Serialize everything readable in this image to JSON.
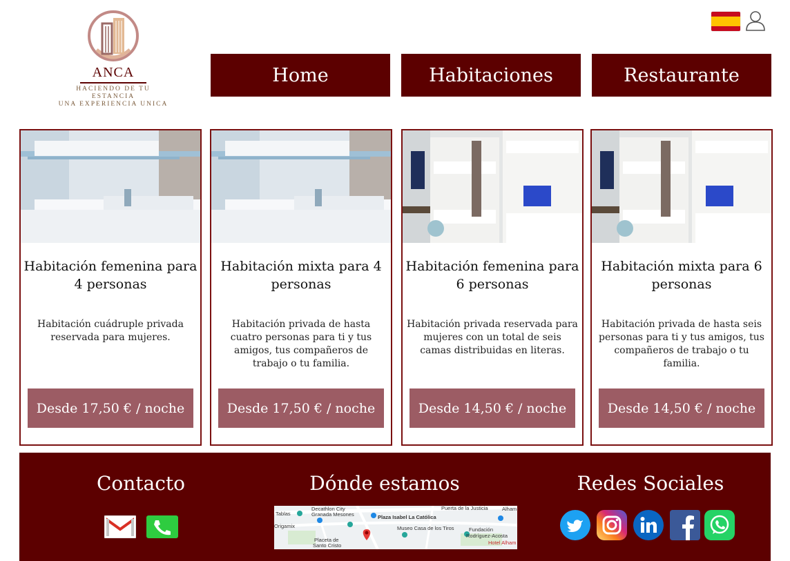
{
  "brand": {
    "name": "ANCA",
    "tagline_1": "HACIENDO DE TU ESTANCIA",
    "tagline_2": "UNA EXPERIENCIA UNICA"
  },
  "colors": {
    "primary": "#5c0000",
    "price_button": "#9c5c64",
    "card_border": "#7a1010"
  },
  "header_icons": {
    "language": "spain-flag-icon",
    "account": "user-icon"
  },
  "nav": [
    {
      "label": "Home"
    },
    {
      "label": "Habitaciones"
    },
    {
      "label": "Restaurante"
    }
  ],
  "rooms": [
    {
      "title": "Habitación femenina para 4 personas",
      "description": "Habitación cuádruple privada reservada para mujeres.",
      "price": "Desde 17,50 € / noche"
    },
    {
      "title": "Habitación mixta para 4 personas",
      "description": "Habitación privada de hasta cuatro personas para ti y tus amigos, tus compañeros de trabajo o tu familia.",
      "price": "Desde 17,50 € / noche"
    },
    {
      "title": "Habitación femenina para 6 personas",
      "description": "Habitación privada reservada para mujeres con un total de seis camas distribuidas en literas.",
      "price": "Desde 14,50 € / noche"
    },
    {
      "title": "Habitación mixta para 6 personas",
      "description": "Habitación privada de hasta seis personas para ti y tus amigos, tus compañeros de trabajo o tu familia.",
      "price": "Desde 14,50 € / noche"
    }
  ],
  "footer": {
    "contact_title": "Contacto",
    "location_title": "Dónde estamos",
    "social_title": "Redes Sociales",
    "contact_icons": [
      "gmail-icon",
      "phone-icon"
    ],
    "social_icons": [
      "twitter-icon",
      "instagram-icon",
      "linkedin-icon",
      "facebook-icon",
      "whatsapp-icon"
    ],
    "map_labels": {
      "l1": "Decathlon City",
      "l2": "Granada Mesones",
      "l3": "Plaza Isabel La Católica",
      "l4": "Puerta de la Justicia",
      "l5": "Alham",
      "l6": "Origamix",
      "l7": "Museo Casa de los Tiros",
      "l8": "Fundación",
      "l9": "Rodríguez-Acosta",
      "l10": "Placeta de",
      "l11": "Santo Cristo",
      "l12": "Hotel Alham",
      "l13": "Tablas"
    }
  }
}
